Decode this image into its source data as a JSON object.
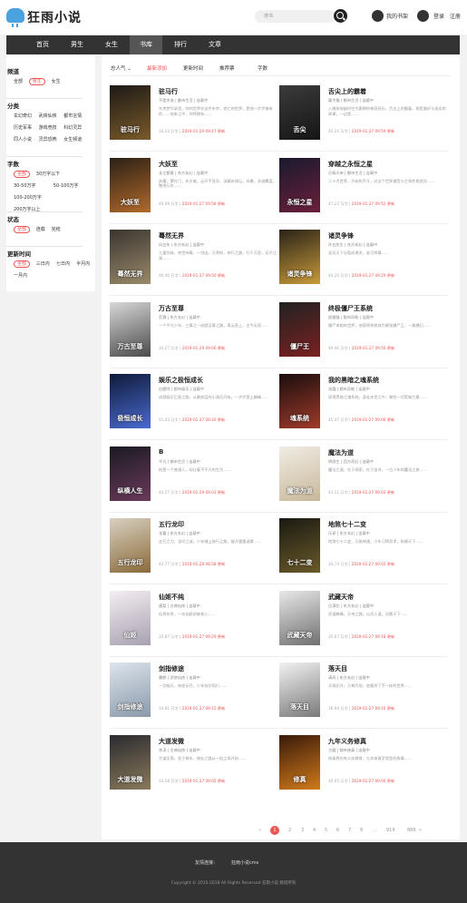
{
  "brand": "狂雨小说",
  "search": {
    "placeholder": "搜书"
  },
  "header": {
    "bookshelf": "我的书架",
    "login": "登录",
    "register": "注册"
  },
  "nav": [
    "首页",
    "男生",
    "女生",
    "书库",
    "排行",
    "文章"
  ],
  "nav_active": 3,
  "sidebar": {
    "groups": [
      {
        "title": "频道",
        "options": [
          "全部",
          "男生",
          "女生"
        ],
        "selected": 1
      },
      {
        "title": "分类",
        "options": [
          "玄幻奇幻",
          "武侠仙侠",
          "都市言情",
          "历史军事",
          "游戏竞技",
          "科幻灵异",
          "同人小说",
          "灵异恐怖",
          "女生频道"
        ],
        "selected": -1
      },
      {
        "title": "字数",
        "options": [
          "全部",
          "30万字以下",
          "30-50万字",
          "50-100万字",
          "100-200万字",
          "200万字以上"
        ],
        "selected": 0
      },
      {
        "title": "状态",
        "options": [
          "全部",
          "连载",
          "完结"
        ],
        "selected": 0
      },
      {
        "title": "更新时间",
        "options": [
          "全部",
          "三日内",
          "七日内",
          "半月内",
          "一月内"
        ],
        "selected": 0
      }
    ]
  },
  "sorts": [
    "总人气 ⌄",
    "最新添加",
    "更新时间",
    "推荐票",
    "字数"
  ],
  "sort_active": 1,
  "books": [
    {
      "title": "驻马行",
      "meta": "不是杰洛 | 都市生活 | 连载中",
      "desc": "东京梦华录里，你的世界在这片东京，杏仁的世界，是他一步步踏来的……他来之中，你将拥有……",
      "updated": "34.23 万字",
      "date": "2019-01-29 09:47 更新",
      "cover_text": "驻马行",
      "c1": "#1d1a16",
      "c2": "#7a5a2a"
    },
    {
      "title": "舌尖上的霸着",
      "meta": "尊大猫 | 都市生活 | 连载中",
      "desc": "入睡前穿越时空大唐朝的神奇经历，舌尖上的霸着，那是美好与现实的故事，一边是……",
      "updated": "45.24 万字",
      "date": "2019-01-27 09:59 更新",
      "cover_text": "舌尖",
      "c1": "#3b3b3b",
      "c2": "#151515"
    },
    {
      "title": "大妖至",
      "meta": "长江都客 | 东方玄幻 | 连载中",
      "desc": "妖魔，孽在门，先灾难，云开不显异，深藏有倾坛，风暴，多维覆度，整地万年……",
      "updated": "40.09 万字",
      "date": "2019-01-27 09:58 更新",
      "cover_text": "大妖至",
      "c1": "#2b2016",
      "c2": "#b26a2a"
    },
    {
      "title": "穿越之永恒之星",
      "meta": "吕杨天帝 | 都市生活 | 连载中",
      "desc": "二十大世界，开始的不凡，对这个世界遭受与主角性格差异……",
      "updated": "47.23 万字",
      "date": "2019-01-27 09:52 更新",
      "cover_text": "永恒之星",
      "c1": "#1a1a2e",
      "c2": "#6a1f3a"
    },
    {
      "title": "蓦然无界",
      "meta": "风五年 | 东方玄幻 | 连载中",
      "desc": "九重剑体，绝世神尊，一剑出，万界惊，修行之路，行千万里，无尽江湖……",
      "updated": "46.40 万字",
      "date": "2019-01-27 09:50 更新",
      "cover_text": "蓦然无界",
      "c1": "#3a3530",
      "c2": "#9a8a6a"
    },
    {
      "title": "诸灵争锋",
      "meta": "孙五先生 | 东方玄幻 | 连载中",
      "desc": "混沌天下分裂成诸灵，谁可称尊……",
      "updated": "44.20 万字",
      "date": "2019-01-27 09:29 更新",
      "cover_text": "诸灵争锋",
      "c1": "#2a2318",
      "c2": "#c89a3a"
    },
    {
      "title": "万古至尊",
      "meta": "范濮 | 东方玄幻 | 连载中",
      "desc": "一个平凡少年，三尊之一成就至尊之路，青云直上，古今无双……",
      "updated": "34.27 万字",
      "date": "2019-01-29 09:06 更新",
      "cover_text": "万古至尊",
      "c1": "#d8d8d8",
      "c2": "#4a4a4a"
    },
    {
      "title": "终极僵尸王系统",
      "meta": "鼠猫猫 | 都市异能 | 连载中",
      "desc": "僵尸来临的世界，他获得系统成为最强僵尸王，一路横扫……",
      "updated": "49.46 万字",
      "date": "2019-01-27 09:56 更新",
      "cover_text": "僵尸王",
      "c1": "#222",
      "c2": "#7a2020"
    },
    {
      "title": "娱乐之极恒成长",
      "meta": "白鹿鸣 | 都市娱乐 | 连载中",
      "desc": "成就娱乐巨星之路，从最底层的小演员开始，一步步登上巅峰……",
      "updated": "51.43 万字",
      "date": "2019-01-27 09:30 更新",
      "cover_text": "极恒成长",
      "c1": "#0e1a3a",
      "c2": "#4a6ad0"
    },
    {
      "title": "我的黑暗之魂系统",
      "meta": "洛霞 | 都市异能 | 连载中",
      "desc": "获得黑暗之魂系统，身处末世之中，掌控一切黑暗力量……",
      "updated": "45.47 万字",
      "date": "2019-01-27 09:06 更新",
      "cover_text": "魂系统",
      "c1": "#1a0e0e",
      "c2": "#a03a2a"
    },
    {
      "title": "B",
      "meta": "平凡 | 都市生活 | 连载中",
      "desc": "他是一个普通人，却过着不平凡的生活……",
      "updated": "40.27 万字",
      "date": "2019-01-29 09:03 更新",
      "cover_text": "纵横人生",
      "c1": "#1a1a22",
      "c2": "#6a3a5a"
    },
    {
      "title": "魔法为道",
      "meta": "阴雨生 | 西方奇幻 | 连载中",
      "desc": "魔法之道，在于探索，在于追寻，一位少年的魔法之旅……",
      "updated": "43.11 万字",
      "date": "2019-01-27 09:02 更新",
      "cover_text": "魔法为道",
      "c1": "#f0ece4",
      "c2": "#c8b89a"
    },
    {
      "title": "五行龙印",
      "meta": "龙嘉 | 东方玄幻 | 连载中",
      "desc": "五行之力，龙印之谜，少年踏上修行之路，破开重重迷雾……",
      "updated": "42.77 万字",
      "date": "2019-01-28 08:58 更新",
      "cover_text": "五行龙印",
      "c1": "#d8d0c0",
      "c2": "#8a6a3a"
    },
    {
      "title": "地煞七十二变",
      "meta": "乐邦 | 东方玄幻 | 连载中",
      "desc": "地煞七十二变，万般神通，少年习得奇术，纵横天下……",
      "updated": "34.74 万字",
      "date": "2019-01-27 09:02 更新",
      "cover_text": "七十二变",
      "c1": "#1a1a12",
      "c2": "#6a5a2a"
    },
    {
      "title": "仙姬不纯",
      "meta": "唐梨 | 古典仙侠 | 连载中",
      "desc": "仙界纷争，一名仙姬却被卷入……",
      "updated": "35.87 万字",
      "date": "2019-01-27 09:29 更新",
      "cover_text": "仙姬",
      "c1": "#f4eef2",
      "c2": "#a8a0b0"
    },
    {
      "title": "武藏天帝",
      "meta": "吕漠北 | 东方玄幻 | 连载中",
      "desc": "武道巅峰，天帝之路，以武入道，问鼎天下……",
      "updated": "35.07 万字",
      "date": "2019-01-27 09:18 更新",
      "cover_text": "武藏天帝",
      "c1": "#e8e8e8",
      "c2": "#707070"
    },
    {
      "title": "剑指修途",
      "meta": "墨鹤 | 武侠仙侠 | 连载中",
      "desc": "一剑指天，修途无尽，少年执剑而行……",
      "updated": "34.81 万字",
      "date": "2019-01-27 09:15 更新",
      "cover_text": "剑指修途",
      "c1": "#dde4ec",
      "c2": "#8a9aaa"
    },
    {
      "title": "落天目",
      "meta": "清风 | 东方玄幻 | 连载中",
      "desc": "天眼初开，万物尽现，他看到了不一样的世界……",
      "updated": "36.94 万字",
      "date": "2019-01-27 09:16 更新",
      "cover_text": "落天目",
      "c1": "#f2f2f2",
      "c2": "#7a7a7a"
    },
    {
      "title": "大道发微",
      "meta": "李淳 | 古典仙侠 | 连载中",
      "desc": "大道至简，发于微末，修仙之路从一粒尘埃开始……",
      "updated": "33.58 万字",
      "date": "2019-01-27 09:05 更新",
      "cover_text": "大道发微",
      "c1": "#2a2a30",
      "c2": "#8a7a5a"
    },
    {
      "title": "九年义务修真",
      "meta": "方圆 | 都市修真 | 连载中",
      "desc": "修真界也有义务教育，九年修真学堂里的故事……",
      "updated": "40.05 万字",
      "date": "2019-01-27 09:00 更新",
      "cover_text": "修真",
      "c1": "#3a1a0a",
      "c2": "#d07a1a"
    }
  ],
  "pager": [
    "«",
    "1",
    "2",
    "3",
    "4",
    "5",
    "6",
    "7",
    "8",
    "...",
    "919",
    "888",
    "»"
  ],
  "pager_current": 1,
  "footer": {
    "links_label": "友情连接：",
    "links": "狂雨小说cms",
    "copyright": "Copyright © 2015-2018 All Rights Reserved 狂雨小说 版权所有"
  }
}
